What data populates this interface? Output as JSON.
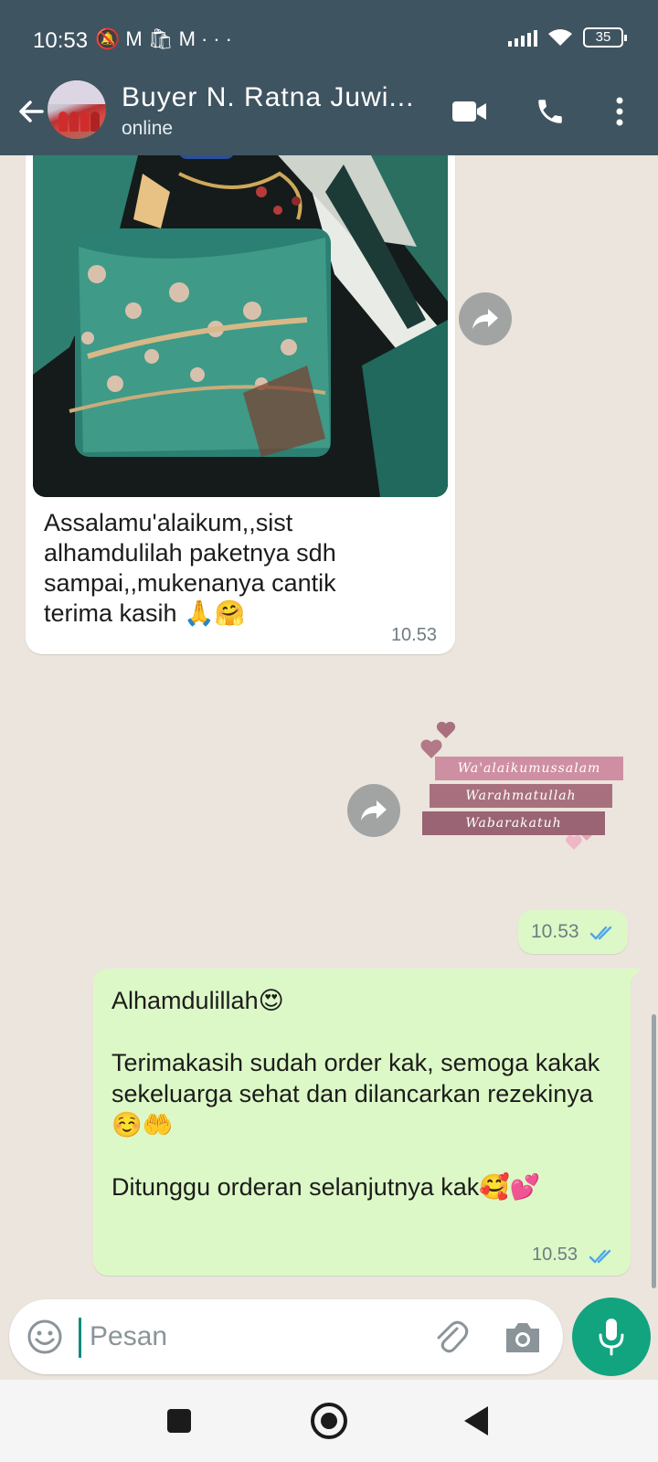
{
  "status_bar": {
    "time": "10:53",
    "battery": "35"
  },
  "header": {
    "contact_name": "Buyer N. Ratna Juwi...",
    "status": "online"
  },
  "messages": {
    "incoming": {
      "text": "Assalamu'alaikum,,sist\nalhamdulilah paketnya sdh\nsampai,,mukenanya cantik\nterima kasih 🙏🤗",
      "time": "10.53"
    },
    "sticker": {
      "lines": [
        "Wa'alaikumussalam",
        "Warahmatullah",
        "Wabarakatuh"
      ],
      "time": "10.53"
    },
    "outgoing": {
      "paragraphs": [
        "Alhamdulillah😍",
        "",
        "Terimakasih sudah order kak, semoga kakak sekeluarga sehat dan dilancarkan rezekinya☺️🤲",
        "",
        "Ditunggu orderan selanjutnya kak🥰💕"
      ],
      "time": "10.53"
    }
  },
  "composer": {
    "placeholder": "Pesan"
  },
  "icons": {
    "status_notifications": [
      "mute-icon",
      "gmail-icon",
      "bag-icon",
      "gmail-icon",
      "more-dots-icon"
    ],
    "header": [
      "back-arrow-icon",
      "video-call-icon",
      "phone-icon",
      "menu-kebab-icon"
    ],
    "composer": [
      "emoji-icon",
      "attach-icon",
      "camera-icon",
      "mic-icon"
    ],
    "navigation": [
      "recents-icon",
      "home-icon",
      "back-icon"
    ]
  },
  "colors": {
    "header_bg": "#3f5461",
    "chat_bg": "#ece5dd",
    "incoming_bubble": "#ffffff",
    "outgoing_bubble": "#dcf8c6",
    "read_ticks": "#4fa6e8",
    "mic_button": "#12a37f",
    "sticker_pink": "#cf8fa2",
    "sticker_mauve": "#a8707f"
  }
}
